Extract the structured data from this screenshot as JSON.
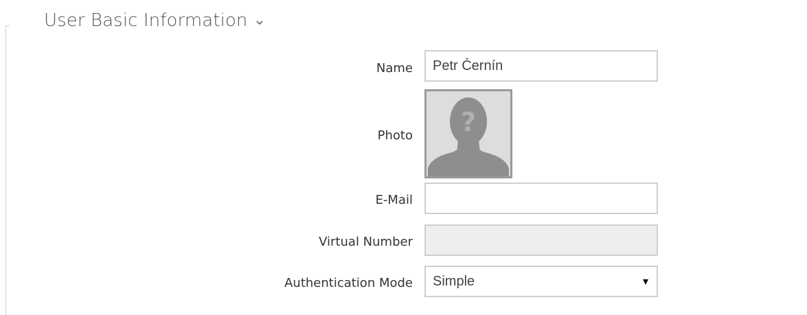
{
  "section": {
    "title": "User Basic Information",
    "chevron_icon": "chevron-down-icon"
  },
  "form": {
    "name": {
      "label": "Name",
      "value": "Petr Černín"
    },
    "photo": {
      "label": "Photo",
      "icon": "unknown-person-icon"
    },
    "email": {
      "label": "E-Mail",
      "value": ""
    },
    "virtual_number": {
      "label": "Virtual Number",
      "value": ""
    },
    "authentication_mode": {
      "label": "Authentication Mode",
      "selected": "Simple",
      "arrow_icon": "dropdown-arrow-icon"
    }
  },
  "colors": {
    "border": "#cfcfcf",
    "disabled_bg": "#eeeeee",
    "photo_border": "#9a9a9a"
  }
}
